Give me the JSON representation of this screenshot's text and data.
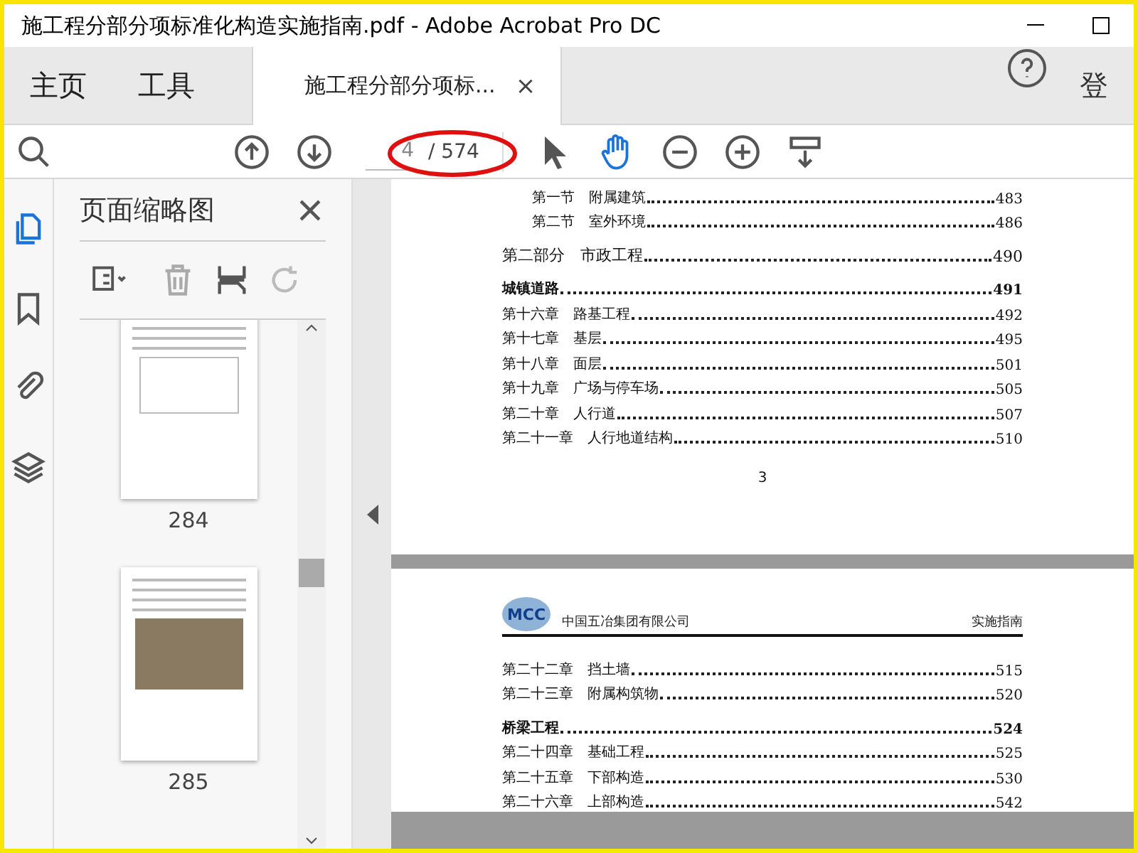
{
  "title_bar": {
    "title": "施工程分部分项标准化构造实施指南.pdf - Adobe Acrobat Pro DC"
  },
  "tabs": [
    {
      "label": "主页",
      "selected": false
    },
    {
      "label": "工具",
      "selected": false
    },
    {
      "label": "施工程分部分项标...",
      "selected": true,
      "close": "×"
    }
  ],
  "account": {
    "label": "登"
  },
  "toolbar": {
    "page_input": "4",
    "page_total": "/ 574",
    "hand_tool_active": true
  },
  "thumbnails_panel": {
    "title": "页面缩略图",
    "thumbnails": [
      {
        "label": "284",
        "kind": "drawing"
      },
      {
        "label": "285",
        "kind": "photo"
      }
    ]
  },
  "document": {
    "pages": [
      {
        "page_number": "3",
        "entries": [
          {
            "kind": "section",
            "title": "第一节　附属建筑",
            "page": "483"
          },
          {
            "kind": "section",
            "title": "第二节　室外环境",
            "page": "486"
          },
          {
            "kind": "part",
            "title": "第二部分　市政工程",
            "page": "490"
          },
          {
            "kind": "heading",
            "title": "城镇道路",
            "page": "491"
          },
          {
            "kind": "chapter",
            "title": "第十六章　路基工程",
            "page": "492"
          },
          {
            "kind": "chapter",
            "title": "第十七章　基层",
            "page": "495"
          },
          {
            "kind": "chapter",
            "title": "第十八章　面层",
            "page": "501"
          },
          {
            "kind": "chapter",
            "title": "第十九章　广场与停车场",
            "page": "505"
          },
          {
            "kind": "chapter",
            "title": "第二十章　人行道",
            "page": "507"
          },
          {
            "kind": "chapter",
            "title": "第二十一章　人行地道结构",
            "page": "510"
          }
        ]
      },
      {
        "header": {
          "logo": "MCC",
          "company": "中国五冶集团有限公司",
          "right": "实施指南"
        },
        "entries": [
          {
            "kind": "chapter",
            "title": "第二十二章　挡土墙",
            "page": "515"
          },
          {
            "kind": "chapter",
            "title": "第二十三章　附属构筑物",
            "page": "520"
          },
          {
            "kind": "heading",
            "title": "桥梁工程",
            "page": "524"
          },
          {
            "kind": "chapter",
            "title": "第二十四章　基础工程",
            "page": "525"
          },
          {
            "kind": "chapter",
            "title": "第二十五章　下部构造",
            "page": "530"
          },
          {
            "kind": "chapter",
            "title": "第二十六章　上部构造",
            "page": "542"
          }
        ]
      }
    ]
  }
}
